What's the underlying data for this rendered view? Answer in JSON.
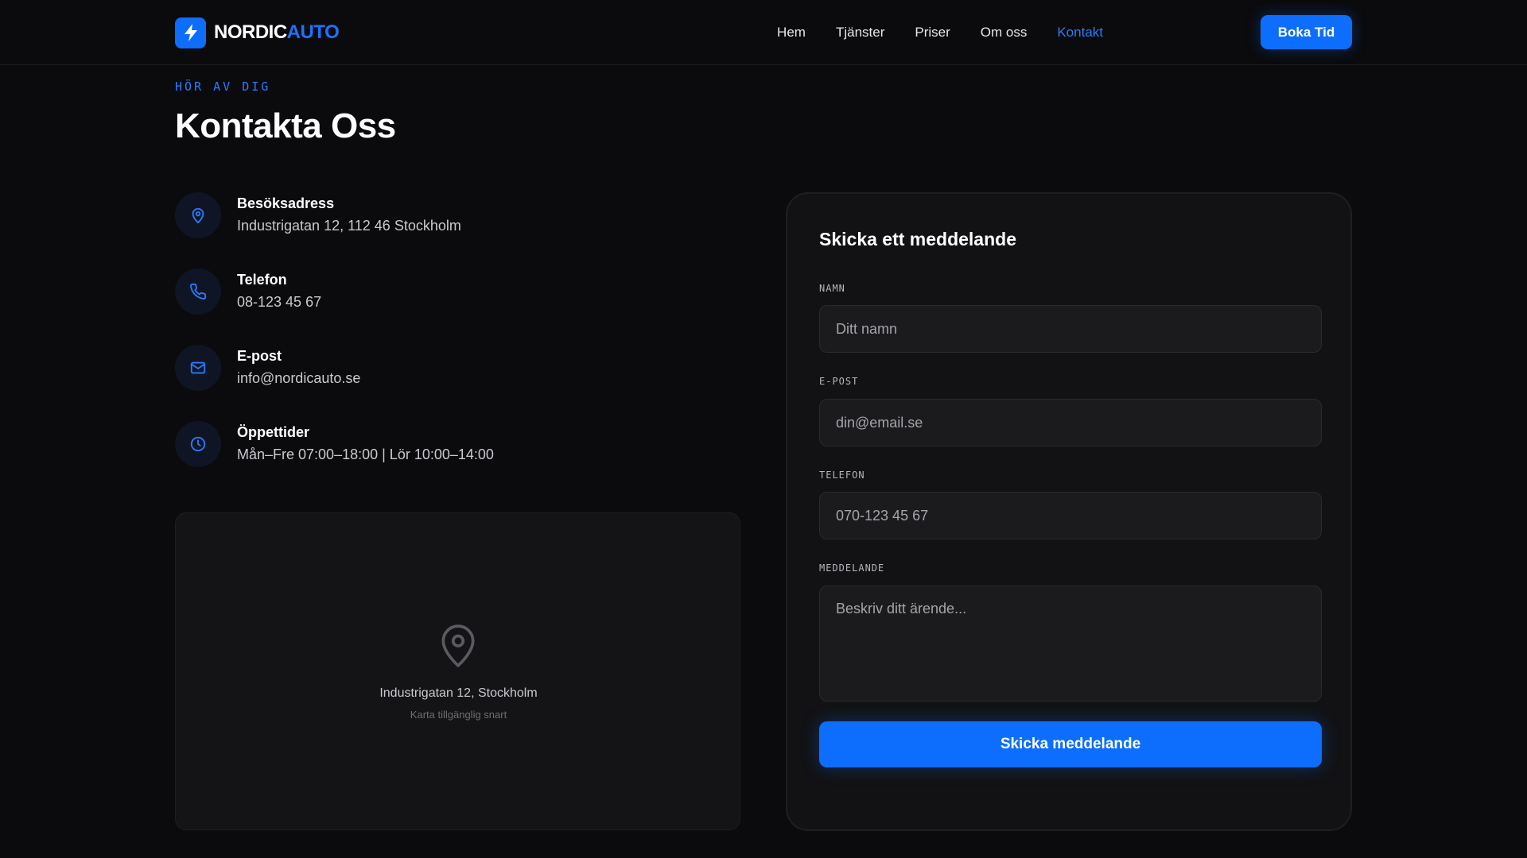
{
  "header": {
    "logo_part1": "NORDIC",
    "logo_part2": "AUTO",
    "nav": [
      "Hem",
      "Tjänster",
      "Priser",
      "Om oss",
      "Kontakt"
    ],
    "active_nav": "Kontakt",
    "cta": "Boka Tid"
  },
  "hero": {
    "eyebrow": "HÖR AV DIG",
    "title": "Kontakta Oss"
  },
  "contact_info": [
    {
      "icon": "map-pin-icon",
      "label": "Besöksadress",
      "value": "Industrigatan 12, 112 46 Stockholm"
    },
    {
      "icon": "phone-icon",
      "label": "Telefon",
      "value": "08-123 45 67"
    },
    {
      "icon": "mail-icon",
      "label": "E-post",
      "value": "info@nordicauto.se"
    },
    {
      "icon": "clock-icon",
      "label": "Öppettider",
      "value": "Mån–Fre 07:00–18:00 | Lör 10:00–14:00"
    }
  ],
  "map": {
    "address": "Industrigatan 12, Stockholm",
    "note": "Karta tillgänglig snart"
  },
  "form": {
    "title": "Skicka ett meddelande",
    "name_label": "NAMN",
    "name_placeholder": "Ditt namn",
    "email_label": "E-POST",
    "email_placeholder": "din@email.se",
    "phone_label": "TELEFON",
    "phone_placeholder": "070-123 45 67",
    "message_label": "MEDDELANDE",
    "message_placeholder": "Beskriv ditt ärende...",
    "submit": "Skicka meddelande"
  },
  "colors": {
    "accent": "#0d6efd",
    "background": "#0b0b0d",
    "card": "#121214"
  }
}
